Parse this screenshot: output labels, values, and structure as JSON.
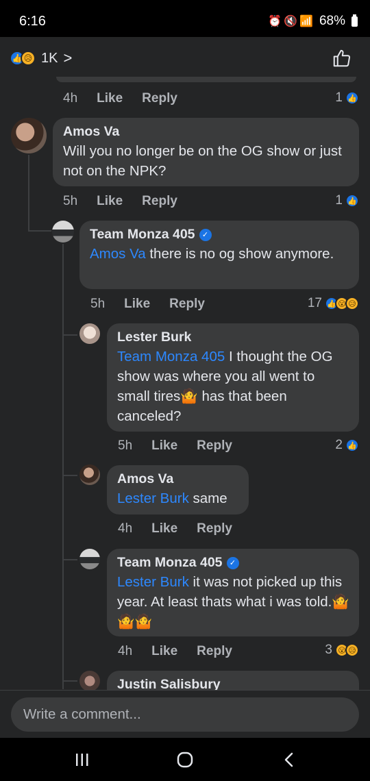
{
  "status": {
    "time": "6:16",
    "battery": "68%"
  },
  "header": {
    "reaction_count": "1K",
    "reactions": [
      "like-icon",
      "sad-icon"
    ]
  },
  "top_comment_meta": {
    "time": "4h",
    "like": "Like",
    "reply": "Reply",
    "reaction_count": "1"
  },
  "comments": [
    {
      "name": "Amos Va",
      "verified": false,
      "mention": "",
      "text": "Will you no longer be on the OG show or just not on the NPK?",
      "time": "5h",
      "like": "Like",
      "reply": "Reply",
      "reaction_count": "1"
    },
    {
      "name": "Team Monza 405",
      "verified": true,
      "mention": "Amos Va",
      "text": " there is no og show anymore.",
      "time": "5h",
      "like": "Like",
      "reply": "Reply",
      "reaction_count": "17"
    },
    {
      "name": "Lester Burk",
      "verified": false,
      "mention": "Team Monza 405",
      "text": " I thought the OG show was where you all went to small tires🤷 has that been canceled?",
      "time": "5h",
      "like": "Like",
      "reply": "Reply",
      "reaction_count": "2"
    },
    {
      "name": "Amos Va",
      "verified": false,
      "mention": "Lester Burk",
      "text": " same",
      "time": "4h",
      "like": "Like",
      "reply": "Reply",
      "reaction_count": ""
    },
    {
      "name": "Team Monza 405",
      "verified": true,
      "mention": "Lester Burk",
      "text": " it was not picked up this year. At least thats what i was told.🤷🤷🤷",
      "time": "4h",
      "like": "Like",
      "reply": "Reply",
      "reaction_count": "3"
    },
    {
      "name": "Justin Salisbury",
      "verified": false,
      "mention": "",
      "text": "",
      "time": "",
      "like": "",
      "reply": "",
      "reaction_count": ""
    }
  ],
  "composer": {
    "placeholder": "Write a comment..."
  },
  "colors": {
    "background": "#242526",
    "bubble": "#3a3b3c",
    "mention": "#2d88ff",
    "like_blue": "#1b74e4"
  }
}
